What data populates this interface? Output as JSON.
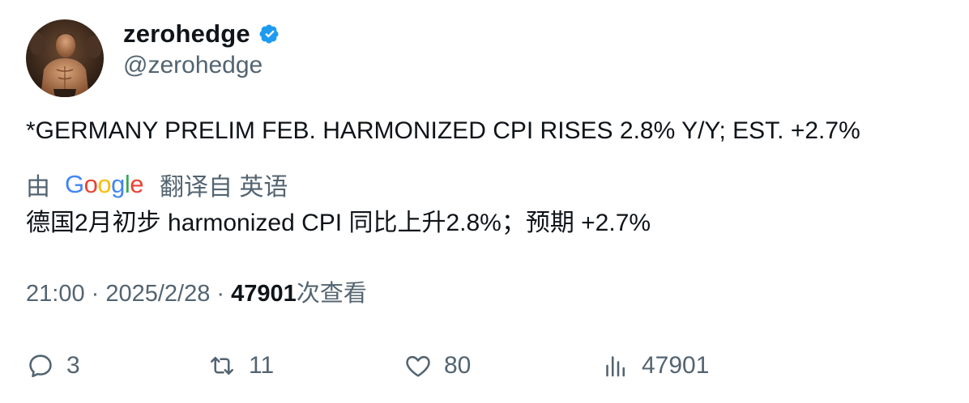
{
  "author": {
    "display_name": "zerohedge",
    "handle": "@zerohedge",
    "verified": true,
    "verified_color": "#1d9bf0"
  },
  "tweet": {
    "text": "*GERMANY PRELIM FEB. HARMONIZED CPI RISES 2.8% Y/Y; EST. +2.7%"
  },
  "translation": {
    "prefix": "由",
    "provider": "Google",
    "provider_letters": [
      {
        "ch": "G",
        "color": "#4285F4"
      },
      {
        "ch": "o",
        "color": "#EA4335"
      },
      {
        "ch": "o",
        "color": "#FBBC05"
      },
      {
        "ch": "g",
        "color": "#4285F4"
      },
      {
        "ch": "l",
        "color": "#34A853"
      },
      {
        "ch": "e",
        "color": "#EA4335"
      }
    ],
    "suffix": "翻译自 英语",
    "text": "德国2月初步 harmonized CPI 同比上升2.8%；预期 +2.7%"
  },
  "meta": {
    "time": "21:00",
    "separator": " · ",
    "date": "2025/2/28",
    "views": "47901",
    "views_label": "次查看"
  },
  "actions": {
    "reply": {
      "icon": "reply-icon",
      "count": "3"
    },
    "retweet": {
      "icon": "retweet-icon",
      "count": "11"
    },
    "like": {
      "icon": "heart-icon",
      "count": "80"
    },
    "views": {
      "icon": "views-chart-icon",
      "count": "47901"
    }
  },
  "colors": {
    "text_primary": "#0f1419",
    "text_secondary": "#536471"
  }
}
